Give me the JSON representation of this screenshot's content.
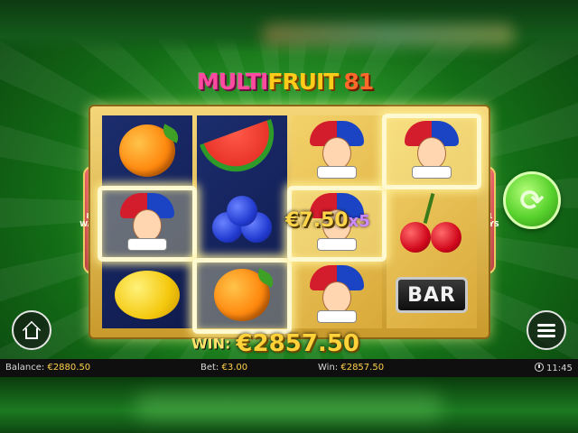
{
  "game": {
    "logo_part1": "MULTI",
    "logo_part2": "FRUIT",
    "logo_number": "81",
    "side_left_label": "81 WAYS",
    "side_right_label": "81 WAYS"
  },
  "reels": [
    [
      "orange",
      "joker",
      "lemon"
    ],
    [
      "watermelon",
      "blueberries",
      "orange"
    ],
    [
      "joker",
      "joker",
      "joker"
    ],
    [
      "joker",
      "cherries",
      "bar"
    ]
  ],
  "symbols": {
    "bar_label": "BAR"
  },
  "line_win": {
    "amount": "€7.50",
    "multiplier": "x5"
  },
  "win_display": {
    "label": "WIN:",
    "amount": "€2857.50"
  },
  "status_bar": {
    "balance_label": "Balance:",
    "balance_value": "€2880.50",
    "bet_label": "Bet:",
    "bet_value": "€3.00",
    "win_label": "Win:",
    "win_value": "€2857.50",
    "time": "11:45"
  },
  "controls": {
    "spin_icon": "refresh-arrows-icon",
    "spin_glyph": "⟳",
    "home_icon": "home-icon",
    "menu_icon": "hamburger-menu-icon"
  },
  "colors": {
    "background_green": "#2fa12c",
    "gold_frame": "#f4d77a",
    "reel_blue": "#1c2d6e",
    "win_gold": "#ffd23a",
    "multiplier_purple": "#c98bff",
    "spin_green": "#57d12c"
  }
}
